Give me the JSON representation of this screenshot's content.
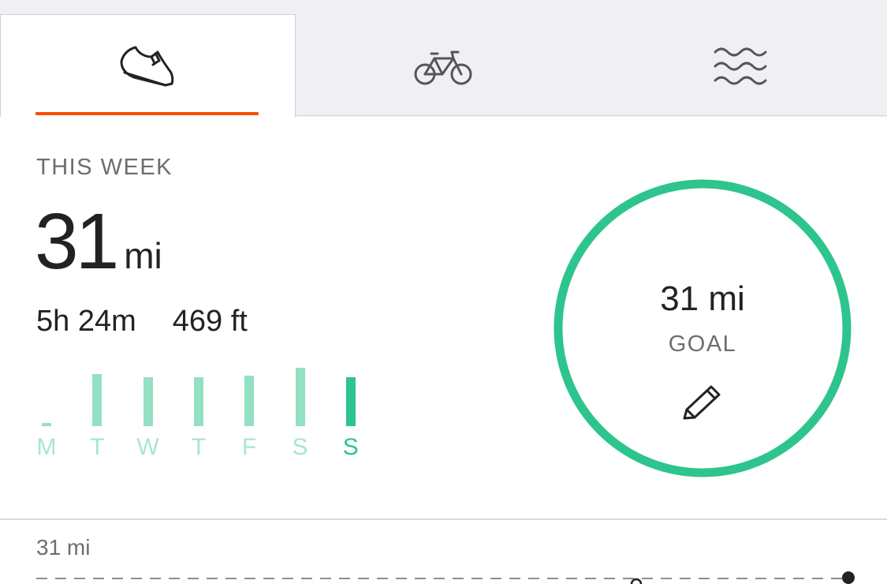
{
  "tabs": [
    {
      "name": "run",
      "icon": "running-shoe-icon",
      "active": true
    },
    {
      "name": "ride",
      "icon": "bicycle-icon",
      "active": false
    },
    {
      "name": "swim",
      "icon": "water-waves-icon",
      "active": false
    }
  ],
  "accent_color": "#fc4c02",
  "progress_color": "#2ec48e",
  "week": {
    "label": "THIS WEEK",
    "distance_value": "31",
    "distance_unit": "mi",
    "time": "5h 24m",
    "elevation": "469 ft"
  },
  "days": [
    {
      "label": "M",
      "value": 0.05,
      "current": false
    },
    {
      "label": "T",
      "value": 0.82,
      "current": false
    },
    {
      "label": "W",
      "value": 0.77,
      "current": false
    },
    {
      "label": "T",
      "value": 0.77,
      "current": false
    },
    {
      "label": "F",
      "value": 0.8,
      "current": false
    },
    {
      "label": "S",
      "value": 0.93,
      "current": false
    },
    {
      "label": "S",
      "value": 0.77,
      "current": true
    }
  ],
  "goal": {
    "value": "31 mi",
    "label": "GOAL",
    "progress": 1.0
  },
  "graph": {
    "label": "31 mi"
  }
}
